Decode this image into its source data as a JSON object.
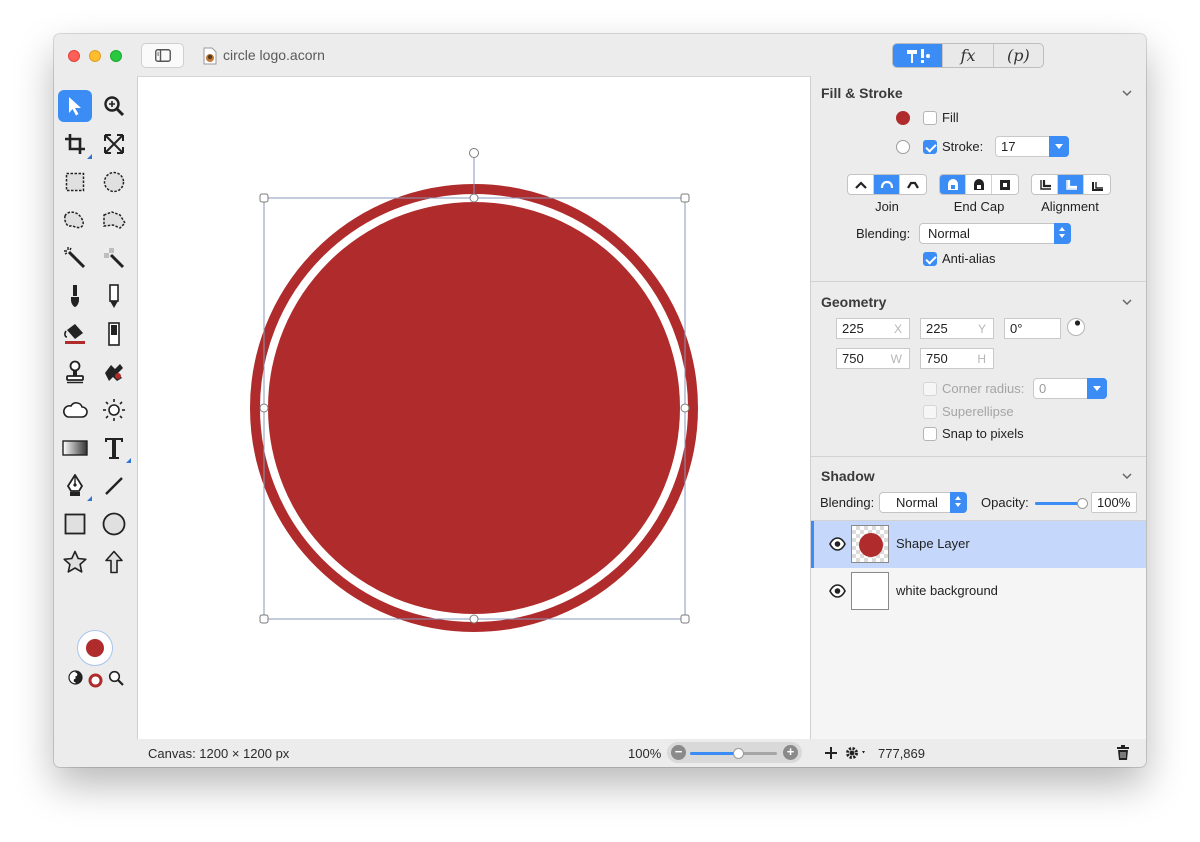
{
  "window": {
    "title": "circle logo.acorn"
  },
  "inspector_tabs": [
    {
      "label": "",
      "icon": "tools-icon",
      "active": true
    },
    {
      "label": "fx",
      "icon": "fx-icon",
      "active": false
    },
    {
      "label": "(p)",
      "icon": "property-icon",
      "active": false
    }
  ],
  "toolbox": {
    "tools": [
      "select-tool",
      "zoom-tool",
      "crop-tool",
      "transform-tool",
      "rect-select-tool",
      "ellipse-select-tool",
      "lasso-tool",
      "polygon-lasso-tool",
      "magic-wand-tool",
      "magic-select-tool",
      "brush-tool",
      "pencil-tool",
      "paint-bucket-tool",
      "gradient-tool",
      "clone-tool",
      "smudge-tool",
      "cloud-tool",
      "sun-tool",
      "gradient-fill-tool",
      "text-tool",
      "pen-tool",
      "line-tool",
      "rectangle-tool",
      "oval-tool",
      "star-tool",
      "arrow-tool"
    ],
    "color": "#b02c2c"
  },
  "canvas": {
    "fill_color": "#b02c2c",
    "stroke_color": "#b02c2c"
  },
  "statusbar": {
    "canvas_size": "Canvas: 1200 × 1200 px",
    "zoom": "100%",
    "zoom_fraction": 0.55
  },
  "fill_stroke": {
    "title": "Fill & Stroke",
    "fill_label": "Fill",
    "fill_checked": false,
    "stroke_label": "Stroke:",
    "stroke_checked": true,
    "stroke_width": "17",
    "join_label": "Join",
    "endcap_label": "End Cap",
    "alignment_label": "Alignment",
    "blending_label": "Blending:",
    "blending_value": "Normal",
    "antialias_label": "Anti-alias",
    "antialias_checked": true
  },
  "geometry": {
    "title": "Geometry",
    "x": "225",
    "x_unit": "X",
    "y": "225",
    "y_unit": "Y",
    "rotation": "0°",
    "w": "750",
    "w_unit": "W",
    "h": "750",
    "h_unit": "H",
    "corner_radius_label": "Corner radius:",
    "corner_radius_value": "0",
    "superellipse_label": "Superellipse",
    "snap_label": "Snap to pixels"
  },
  "shadow": {
    "title": "Shadow"
  },
  "layer_options": {
    "blending_label": "Blending:",
    "blending_value": "Normal",
    "opacity_label": "Opacity:",
    "opacity_value": "100%",
    "opacity_fraction": 1.0
  },
  "layers": [
    {
      "name": "Shape Layer",
      "selected": true
    },
    {
      "name": "white background",
      "selected": false
    }
  ],
  "panel_status": {
    "coords": "777,869"
  }
}
